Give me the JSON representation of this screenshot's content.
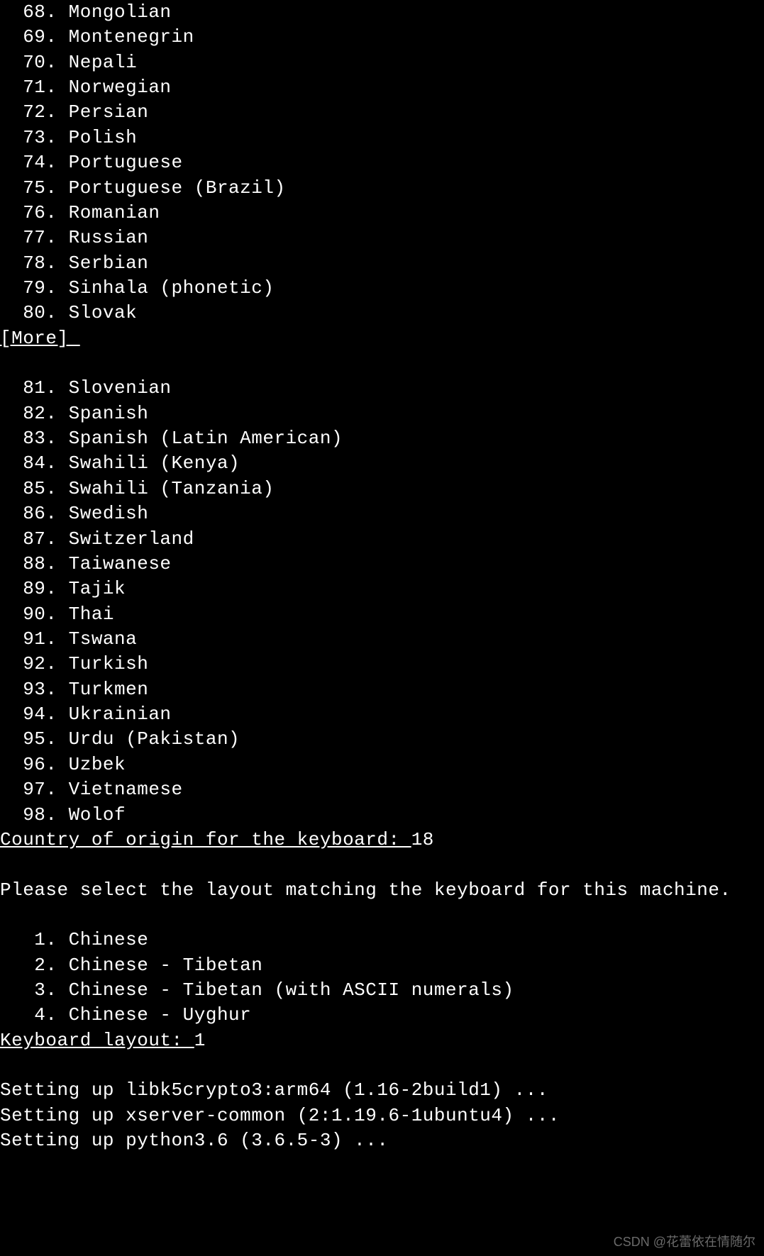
{
  "language_list_1": [
    {
      "num": "68",
      "name": "Mongolian"
    },
    {
      "num": "69",
      "name": "Montenegrin"
    },
    {
      "num": "70",
      "name": "Nepali"
    },
    {
      "num": "71",
      "name": "Norwegian"
    },
    {
      "num": "72",
      "name": "Persian"
    },
    {
      "num": "73",
      "name": "Polish"
    },
    {
      "num": "74",
      "name": "Portuguese"
    },
    {
      "num": "75",
      "name": "Portuguese (Brazil)"
    },
    {
      "num": "76",
      "name": "Romanian"
    },
    {
      "num": "77",
      "name": "Russian"
    },
    {
      "num": "78",
      "name": "Serbian"
    },
    {
      "num": "79",
      "name": "Sinhala (phonetic)"
    },
    {
      "num": "80",
      "name": "Slovak"
    }
  ],
  "more_label": "[More] ",
  "language_list_2": [
    {
      "num": "81",
      "name": "Slovenian"
    },
    {
      "num": "82",
      "name": "Spanish"
    },
    {
      "num": "83",
      "name": "Spanish (Latin American)"
    },
    {
      "num": "84",
      "name": "Swahili (Kenya)"
    },
    {
      "num": "85",
      "name": "Swahili (Tanzania)"
    },
    {
      "num": "86",
      "name": "Swedish"
    },
    {
      "num": "87",
      "name": "Switzerland"
    },
    {
      "num": "88",
      "name": "Taiwanese"
    },
    {
      "num": "89",
      "name": "Tajik"
    },
    {
      "num": "90",
      "name": "Thai"
    },
    {
      "num": "91",
      "name": "Tswana"
    },
    {
      "num": "92",
      "name": "Turkish"
    },
    {
      "num": "93",
      "name": "Turkmen"
    },
    {
      "num": "94",
      "name": "Ukrainian"
    },
    {
      "num": "95",
      "name": "Urdu (Pakistan)"
    },
    {
      "num": "96",
      "name": "Uzbek"
    },
    {
      "num": "97",
      "name": "Vietnamese"
    },
    {
      "num": "98",
      "name": "Wolof"
    }
  ],
  "country_prompt": "Country of origin for the keyboard: ",
  "country_answer": "18",
  "instruction_text": "Please select the layout matching the keyboard for this machine.",
  "layout_list": [
    {
      "num": "1",
      "name": "Chinese"
    },
    {
      "num": "2",
      "name": "Chinese - Tibetan"
    },
    {
      "num": "3",
      "name": "Chinese - Tibetan (with ASCII numerals)"
    },
    {
      "num": "4",
      "name": "Chinese - Uyghur"
    }
  ],
  "layout_prompt": "Keyboard layout: ",
  "layout_answer": "1",
  "status_lines": [
    "Setting up libk5crypto3:arm64 (1.16-2build1) ...",
    "Setting up xserver-common (2:1.19.6-1ubuntu4) ...",
    "Setting up python3.6 (3.6.5-3) ..."
  ],
  "watermark": "CSDN @花蕾依在情随尔"
}
